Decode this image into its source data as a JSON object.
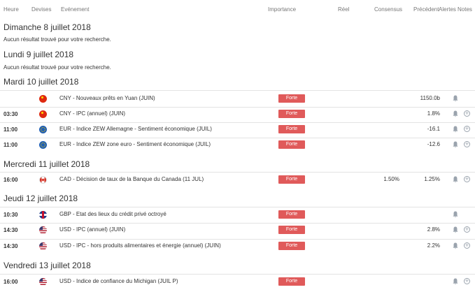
{
  "header": {
    "heure": "Heure",
    "devises": "Devises",
    "evenement": "Evénement",
    "importance": "Importance",
    "reel": "Réel",
    "consensus": "Consensus",
    "precedent": "Précédent",
    "alertes": "Alertes",
    "notes": "Notes"
  },
  "days": {
    "sun": {
      "title": "Dimanche 8 juillet 2018",
      "empty": "Aucun résultat trouvé pour votre recherche."
    },
    "mon": {
      "title": "Lundi 9 juillet 2018",
      "empty": "Aucun résultat trouvé pour votre recherche."
    },
    "tue": {
      "title": "Mardi 10 juillet 2018"
    },
    "wed": {
      "title": "Mercredi 11 juillet 2018"
    },
    "thu": {
      "title": "Jeudi 12 juillet 2018"
    },
    "fri": {
      "title": "Vendredi 13 juillet 2018"
    }
  },
  "rows": [
    {
      "time": "",
      "flag": "china-flag",
      "event": "CNY - Nouveaux prêts en Yuan (JUIN)",
      "importance": "Forte",
      "consensus": "",
      "previous": "1150.0b",
      "plus": false
    },
    {
      "time": "03:30",
      "flag": "china-flag",
      "event": "CNY - IPC (annuel) (JUIN)",
      "importance": "Forte",
      "consensus": "",
      "previous": "1.8%",
      "plus": true
    },
    {
      "time": "11:00",
      "flag": "eu-flag",
      "event": "EUR - Indice ZEW Allemagne - Sentiment économique (JUIL)",
      "importance": "Forte",
      "consensus": "",
      "previous": "-16.1",
      "plus": true
    },
    {
      "time": "11:00",
      "flag": "eu-flag",
      "event": "EUR - Indice ZEW zone euro - Sentiment économique (JUIL)",
      "importance": "Forte",
      "consensus": "",
      "previous": "-12.6",
      "plus": true
    },
    {
      "time": "16:00",
      "flag": "canada-flag",
      "event": "CAD - Décision de taux de la Banque du Canada (11 JUL)",
      "importance": "Forte",
      "consensus": "1.50%",
      "previous": "1.25%",
      "plus": true
    },
    {
      "time": "10:30",
      "flag": "uk-flag",
      "event": "GBP - Etat des lieux du crédit privé octroyé",
      "importance": "Forte",
      "consensus": "",
      "previous": "",
      "plus": false
    },
    {
      "time": "14:30",
      "flag": "usa-flag",
      "event": "USD - IPC (annuel) (JUIN)",
      "importance": "Forte",
      "consensus": "",
      "previous": "2.8%",
      "plus": true
    },
    {
      "time": "14:30",
      "flag": "usa-flag",
      "event": "USD - IPC - hors produits alimentaires et énergie (annuel) (JUIN)",
      "importance": "Forte",
      "consensus": "",
      "previous": "2.2%",
      "plus": true
    },
    {
      "time": "16:00",
      "flag": "usa-flag",
      "event": "USD - Indice de confiance du Michigan (JUIL P)",
      "importance": "Forte",
      "consensus": "",
      "previous": "",
      "plus": true
    }
  ],
  "icons": {
    "alert": "bell-icon",
    "note": "plus-circle-icon"
  },
  "colors": {
    "importance_high": "#e05a5a",
    "separator": "#e3e3e3",
    "icon": "#9aa3ad"
  }
}
